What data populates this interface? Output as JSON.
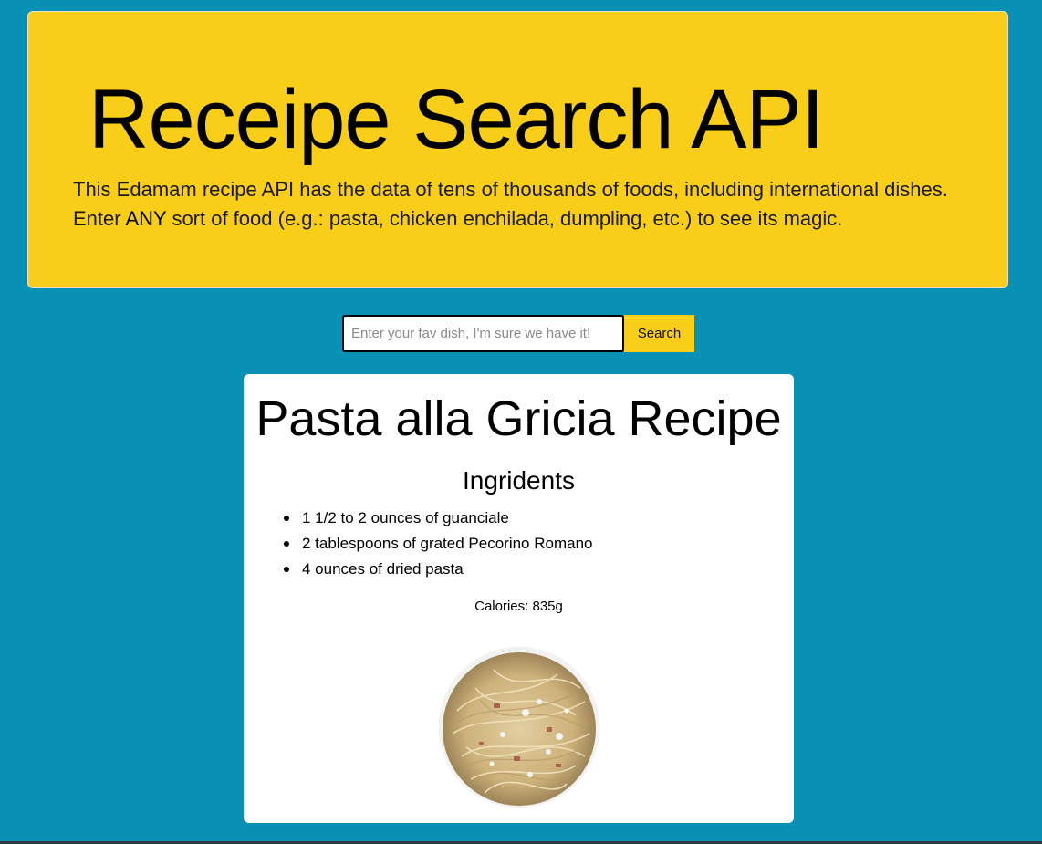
{
  "hero": {
    "title": "Receipe Search API",
    "description_line1": "This Edamam recipe API has the data of tens of thousands of foods, including international dishes.",
    "description_line2_prefix": "Enter ",
    "description_line2_strong": "ANY",
    "description_line2_suffix": " sort of food (e.g.: pasta, chicken enchilada, dumpling, etc.) to see its magic."
  },
  "search": {
    "placeholder": "Enter your fav dish, I'm sure we have it!",
    "value": "",
    "button_label": "Search"
  },
  "recipe": {
    "title": "Pasta alla Gricia Recipe",
    "ingredients_heading": "Ingridents",
    "ingredients": [
      "1 1/2 to 2 ounces of guanciale",
      "2 tablespoons of grated Pecorino Romano",
      "4 ounces of dried pasta"
    ],
    "calories": "Calories: 835g",
    "image_icon": "pasta-dish-photo"
  },
  "colors": {
    "background": "#0891b5",
    "accent": "#f9ce18",
    "card": "#ffffff"
  }
}
